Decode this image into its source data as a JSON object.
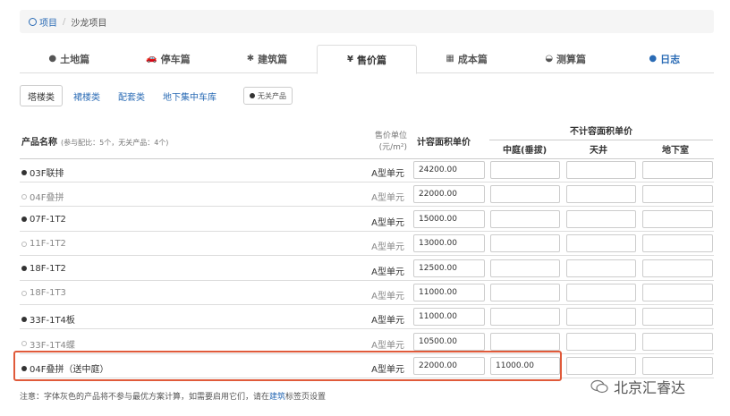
{
  "breadcrumb": {
    "root": "项目",
    "current": "沙龙项目"
  },
  "tabs": [
    {
      "label": "土地篇",
      "icon": "●"
    },
    {
      "label": "停车篇",
      "icon": "🚗"
    },
    {
      "label": "建筑篇",
      "icon": "✱"
    },
    {
      "label": "售价篇",
      "icon": "¥"
    },
    {
      "label": "成本篇",
      "icon": "▦"
    },
    {
      "label": "测算篇",
      "icon": "◒"
    },
    {
      "label": "日志",
      "icon": "●"
    }
  ],
  "subtabs": [
    "塔楼类",
    "裙楼类",
    "配套类",
    "地下集中车库"
  ],
  "nolink_label": "无关产品",
  "header": {
    "name": "产品名称",
    "name_note": "(参与配比：5个，无关产品：4个)",
    "unit_line1": "售价单位",
    "unit_line2": "(元/m²)",
    "price": "计容面积单价",
    "noncount": "不计容面积单价",
    "sub1": "中庭(垂拔)",
    "sub2": "天井",
    "sub3": "地下室"
  },
  "rows": [
    {
      "name": "03F联排",
      "active": true,
      "unit": "A型单元",
      "price": "24200.00",
      "c1": ""
    },
    {
      "name": "04F叠拼",
      "active": false,
      "unit": "A型单元",
      "price": "22000.00",
      "c1": ""
    },
    {
      "name": "07F-1T2",
      "active": true,
      "unit": "A型单元",
      "price": "15000.00",
      "c1": ""
    },
    {
      "name": "11F-1T2",
      "active": false,
      "unit": "A型单元",
      "price": "13000.00",
      "c1": ""
    },
    {
      "name": "18F-1T2",
      "active": true,
      "unit": "A型单元",
      "price": "12500.00",
      "c1": ""
    },
    {
      "name": "18F-1T3",
      "active": false,
      "unit": "A型单元",
      "price": "11000.00",
      "c1": ""
    },
    {
      "name": "33F-1T4板",
      "active": true,
      "unit": "A型单元",
      "price": "11000.00",
      "c1": ""
    },
    {
      "name": "33F-1T4蝶",
      "active": false,
      "unit": "A型单元",
      "price": "10500.00",
      "c1": ""
    },
    {
      "name": "04F叠拼（送中庭）",
      "active": true,
      "unit": "A型单元",
      "price": "22000.00",
      "c1": "11000.00"
    }
  ],
  "footnote": {
    "prefix": "注意：字体灰色的产品将不参与最优方案计算，如需要启用它们，请在",
    "link": "建筑",
    "suffix": "标签页设置"
  },
  "watermark": "北京汇睿达"
}
